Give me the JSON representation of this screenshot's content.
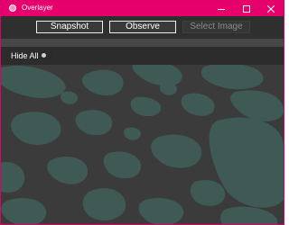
{
  "window": {
    "title": "Overlayer",
    "title_bar_color": "#e6006b",
    "border_color": "#e0006a",
    "controls": {
      "minimize": "minimize-icon",
      "maximize": "maximize-icon",
      "close": "close-icon"
    }
  },
  "toolbar": {
    "snapshot_label": "Snapshot",
    "observe_label": "Observe",
    "select_image_label": "Select Image",
    "select_image_enabled": false
  },
  "hide_all": {
    "label": "Hide All",
    "toggle_on": false
  },
  "canvas": {
    "background": "#3b3b3b",
    "blob_color": "#3f5a54"
  }
}
